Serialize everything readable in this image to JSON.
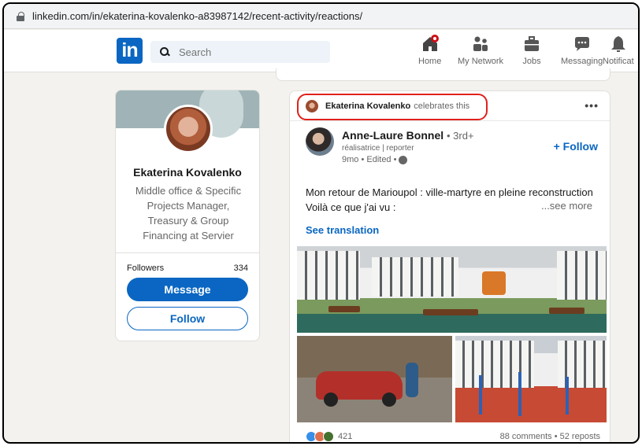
{
  "browser": {
    "url": "linkedin.com/in/ekaterina-kovalenko-a83987142/recent-activity/reactions/"
  },
  "nav": {
    "logo": "in",
    "search_placeholder": "Search",
    "items": [
      {
        "label": "Home",
        "icon": "home-icon"
      },
      {
        "label": "My Network",
        "icon": "network-icon"
      },
      {
        "label": "Jobs",
        "icon": "jobs-icon"
      },
      {
        "label": "Messaging",
        "icon": "messaging-icon"
      },
      {
        "label": "Notificat",
        "icon": "bell-icon"
      }
    ]
  },
  "profile": {
    "name": "Ekaterina Kovalenko",
    "headline": "Middle office & Specific Projects Manager, Treasury & Group Financing at Servier",
    "followers_label": "Followers",
    "followers_count": "334",
    "message_label": "Message",
    "follow_label": "Follow"
  },
  "post": {
    "celebrator": "Ekaterina Kovalenko",
    "celebrate_text": "celebrates this",
    "author_name": "Anne-Laure Bonnel",
    "author_degree": "• 3rd+",
    "author_subtitle": "réalisatrice | reporter",
    "time": "9mo • Edited •",
    "follow_label": "+ Follow",
    "text_line1": "Mon retour de Marioupol : ville-martyre en pleine reconstruction",
    "text_line2": "Voilà ce que j'ai vu :",
    "see_more": "...see more",
    "see_translation": "See translation",
    "reaction_count": "421",
    "comments_reposts": "88 comments • 52 reposts"
  },
  "colors": {
    "brand": "#0a66c2",
    "highlight": "#e0211c"
  }
}
